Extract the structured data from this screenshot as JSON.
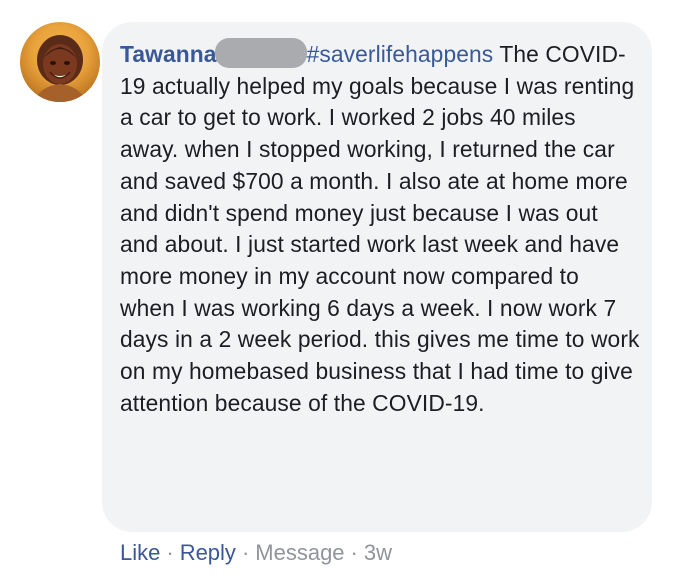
{
  "comment": {
    "author_name": "Tawanna",
    "hashtag": "#saverlifehappens",
    "body": " The COVID-19 actually helped my goals because I was renting a car to get to work. I worked 2 jobs 40 miles away. when I stopped working, I returned the car and saved $700 a month. I also ate at home more and didn't spend money just because I was out and about. I just started work last week and have more money in my account now compared to when I was working 6 days a week. I now work 7 days in a 2 week period. this gives me time to work on my homebased business that I had time to give attention because of the COVID-19."
  },
  "actions": {
    "like": "Like",
    "reply": "Reply",
    "message": "Message",
    "timestamp": "3w",
    "separator": "·"
  },
  "colors": {
    "link": "#385898",
    "muted": "#90949c",
    "bubble": "#f2f3f5",
    "text": "#1c1e21"
  }
}
